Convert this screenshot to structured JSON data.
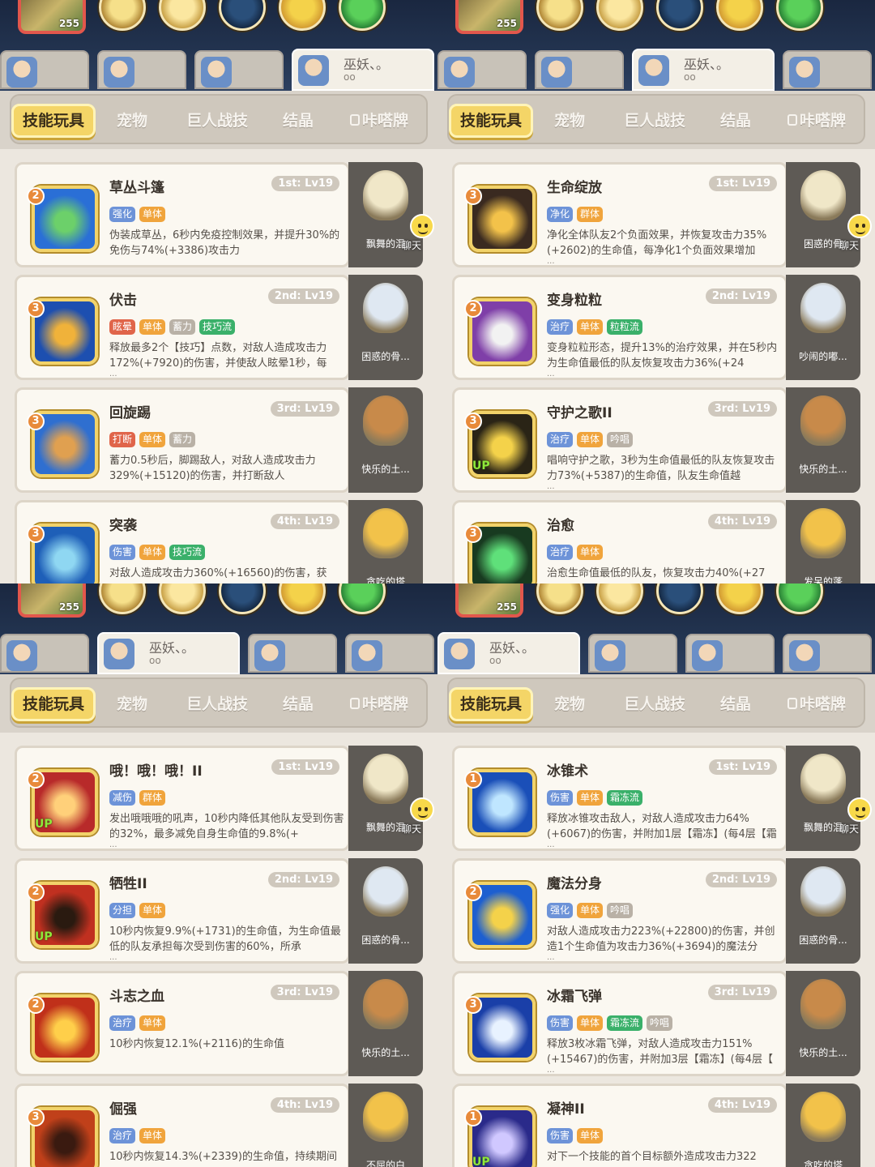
{
  "colors": {
    "tag_blue": "#6d93d8",
    "tag_orange": "#f0a43c",
    "tag_red": "#e0654a",
    "tag_green": "#3ab06a",
    "tag_grey": "#b9b1a6",
    "selected_tab": "#f4d567"
  },
  "panels": [
    {
      "level": "255",
      "header_tabs": [
        {
          "name": "",
          "sub": ""
        },
        {
          "name": "",
          "sub": ""
        },
        {
          "name": "",
          "sub": ""
        },
        {
          "name": "巫妖、。",
          "sub": "oo"
        }
      ],
      "nav": {
        "tabs": [
          "技能玩具",
          "宠物",
          "巨人战技",
          "结晶",
          "咔嗒牌"
        ],
        "selected": 0
      },
      "cards": [
        {
          "rank": "2",
          "up": "",
          "name": "草丛斗篷",
          "level": "1st: Lv19",
          "tags": [
            "强化",
            "单体"
          ],
          "desc": "伪装成草丛，6秒内免疫控制效果，并提升30%的免伤与74%(+3386)攻击力",
          "more": "",
          "pet": "飘舞的混",
          "chat": "聊天"
        },
        {
          "rank": "3",
          "up": "",
          "name": "伏击",
          "level": "2nd: Lv19",
          "tags": [
            "眩晕",
            "单体",
            "蓄力",
            "技巧流"
          ],
          "desc": "释放最多2个【技巧】点数，对敌人造成攻击力172%(+7920)的伤害，并使敌人眩晕1秒，每",
          "more": "...",
          "pet": "困惑的骨...",
          "chat": ""
        },
        {
          "rank": "3",
          "up": "",
          "name": "回旋踢",
          "level": "3rd: Lv19",
          "tags": [
            "打断",
            "单体",
            "蓄力"
          ],
          "desc": "蓄力0.5秒后，脚踢敌人，对敌人造成攻击力329%(+15120)的伤害，并打断敌人",
          "more": "",
          "pet": "快乐的土...",
          "chat": ""
        },
        {
          "rank": "3",
          "up": "",
          "name": "突袭",
          "level": "4th: Lv19",
          "tags": [
            "伤害",
            "单体",
            "技巧流"
          ],
          "desc": "对敌人造成攻击力360%(+16560)的伤害，获",
          "more": "",
          "pet": "贪吃的塔",
          "chat": ""
        }
      ]
    },
    {
      "level": "255",
      "header_tabs": [
        {
          "name": "",
          "sub": ""
        },
        {
          "name": "",
          "sub": ""
        },
        {
          "name": "巫妖、。",
          "sub": "oo"
        },
        {
          "name": "",
          "sub": ""
        }
      ],
      "nav": {
        "tabs": [
          "技能玩具",
          "宠物",
          "巨人战技",
          "结晶",
          "咔嗒牌"
        ],
        "selected": 0
      },
      "cards": [
        {
          "rank": "3",
          "up": "",
          "name": "生命绽放",
          "level": "1st: Lv19",
          "tags": [
            "净化",
            "群体"
          ],
          "desc": "净化全体队友2个负面效果，并恢复攻击力35%(+2602)的生命值，每净化1个负面效果增加",
          "more": "...",
          "pet": "困惑的骨",
          "chat": "聊天"
        },
        {
          "rank": "2",
          "up": "",
          "name": "变身粒粒",
          "level": "2nd: Lv19",
          "tags": [
            "治疗",
            "单体",
            "粒粒流"
          ],
          "desc": "变身粒粒形态，提升13%的治疗效果，并在5秒内为生命值最低的队友恢复攻击力36%(+24",
          "more": "...",
          "pet": "吵闹的嘟...",
          "chat": ""
        },
        {
          "rank": "3",
          "up": "UP",
          "name": "守护之歌II",
          "level": "3rd: Lv19",
          "tags": [
            "治疗",
            "单体",
            "吟唱"
          ],
          "desc": "唱响守护之歌，3秒为生命值最低的队友恢复攻击力73%(+5387)的生命值，队友生命值越",
          "more": "...",
          "pet": "快乐的土...",
          "chat": ""
        },
        {
          "rank": "3",
          "up": "",
          "name": "治愈",
          "level": "4th: Lv19",
          "tags": [
            "治疗",
            "单体"
          ],
          "desc": "治愈生命值最低的队友，恢复攻击力40%(+27",
          "more": "",
          "pet": "发呆的蓬",
          "chat": ""
        }
      ]
    },
    {
      "level": "255",
      "header_tabs": [
        {
          "name": "",
          "sub": ""
        },
        {
          "name": "巫妖、。",
          "sub": "oo"
        },
        {
          "name": "",
          "sub": ""
        },
        {
          "name": "",
          "sub": ""
        }
      ],
      "nav": {
        "tabs": [
          "技能玩具",
          "宠物",
          "巨人战技",
          "结晶",
          "咔嗒牌"
        ],
        "selected": 0
      },
      "cards": [
        {
          "rank": "2",
          "up": "UP",
          "name": "哦！哦！哦！II",
          "level": "1st: Lv19",
          "tags": [
            "减伤",
            "群体"
          ],
          "desc": "发出哦哦哦的吼声，10秒内降低其他队友受到伤害的32%，最多减免自身生命值的9.8%(+",
          "more": "...",
          "pet": "飘舞的混",
          "chat": "聊天"
        },
        {
          "rank": "2",
          "up": "UP",
          "name": "牺牲II",
          "level": "2nd: Lv19",
          "tags": [
            "分担",
            "单体"
          ],
          "desc": "10秒内恢复9.9%(+1731)的生命值，为生命值最低的队友承担每次受到伤害的60%，所承",
          "more": "...",
          "pet": "困惑的骨...",
          "chat": ""
        },
        {
          "rank": "2",
          "up": "",
          "name": "斗志之血",
          "level": "3rd: Lv19",
          "tags": [
            "治疗",
            "单体"
          ],
          "desc": "10秒内恢复12.1%(+2116)的生命值",
          "more": "",
          "pet": "快乐的土...",
          "chat": ""
        },
        {
          "rank": "3",
          "up": "",
          "name": "倔强",
          "level": "4th: Lv19",
          "tags": [
            "治疗",
            "单体"
          ],
          "desc": "10秒内恢复14.3%(+2339)的生命值，持续期间",
          "more": "",
          "pet": "不屈的白",
          "chat": ""
        }
      ]
    },
    {
      "level": "255",
      "header_tabs": [
        {
          "name": "巫妖、。",
          "sub": "oo"
        },
        {
          "name": "",
          "sub": ""
        },
        {
          "name": "",
          "sub": ""
        },
        {
          "name": "",
          "sub": ""
        }
      ],
      "nav": {
        "tabs": [
          "技能玩具",
          "宠物",
          "巨人战技",
          "结晶",
          "咔嗒牌"
        ],
        "selected": 0
      },
      "cards": [
        {
          "rank": "1",
          "up": "",
          "name": "冰锥术",
          "level": "1st: Lv19",
          "tags": [
            "伤害",
            "单体",
            "霜冻流"
          ],
          "desc": "释放冰锥攻击敌人，对敌人造成攻击力64%(+6067)的伤害，并附加1层【霜冻】(每4层【霜",
          "more": "...",
          "pet": "飘舞的混",
          "chat": "聊天"
        },
        {
          "rank": "2",
          "up": "",
          "name": "魔法分身",
          "level": "2nd: Lv19",
          "tags": [
            "强化",
            "单体",
            "吟唱"
          ],
          "desc": "对敌人造成攻击力223%(+22800)的伤害，并创造1个生命值为攻击力36%(+3694)的魔法分",
          "more": "...",
          "pet": "困惑的骨...",
          "chat": ""
        },
        {
          "rank": "3",
          "up": "",
          "name": "冰霜飞弹",
          "level": "3rd: Lv19",
          "tags": [
            "伤害",
            "单体",
            "霜冻流",
            "吟唱"
          ],
          "desc": "释放3枚冰霜飞弹，对敌人造成攻击力151%(+15467)的伤害，并附加3层【霜冻】(每4层【",
          "more": "...",
          "pet": "快乐的土...",
          "chat": ""
        },
        {
          "rank": "1",
          "up": "UP",
          "name": "凝神II",
          "level": "4th: Lv19",
          "tags": [
            "伤害",
            "单体"
          ],
          "desc": "对下一个技能的首个目标额外造成攻击力322",
          "more": "",
          "pet": "贪吃的塔",
          "chat": ""
        }
      ]
    }
  ]
}
